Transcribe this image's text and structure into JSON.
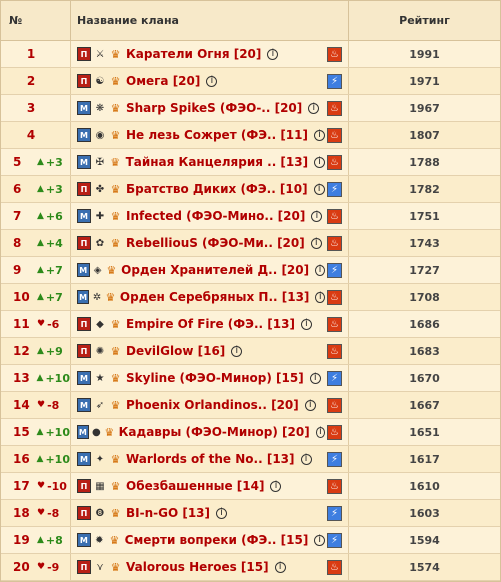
{
  "header": {
    "no": "№",
    "name": "Название клана",
    "rating": "Рейтинг"
  },
  "rows": [
    {
      "pos": "1",
      "change": "",
      "dir": "",
      "align": "П",
      "emblem": "⚔",
      "name": "Каратели Огня [20]",
      "element": "fire",
      "rating": "1991"
    },
    {
      "pos": "2",
      "change": "",
      "dir": "",
      "align": "П",
      "emblem": "☯",
      "name": "Омега [20]",
      "element": "air",
      "rating": "1971"
    },
    {
      "pos": "3",
      "change": "",
      "dir": "",
      "align": "М",
      "emblem": "❋",
      "name": "Sharp SpikeS (ФЭО-.. [20]",
      "element": "fire",
      "rating": "1967"
    },
    {
      "pos": "4",
      "change": "",
      "dir": "",
      "align": "М",
      "emblem": "◉",
      "name": "Не лезь Сожрет (ФЭ.. [11]",
      "element": "fire",
      "rating": "1807"
    },
    {
      "pos": "5",
      "change": "+3",
      "dir": "up",
      "align": "М",
      "emblem": "✠",
      "name": "Тайная Канцелярия .. [13]",
      "element": "fire",
      "rating": "1788"
    },
    {
      "pos": "6",
      "change": "+3",
      "dir": "up",
      "align": "П",
      "emblem": "✤",
      "name": "Братство Диких (ФЭ.. [10]",
      "element": "air",
      "rating": "1782"
    },
    {
      "pos": "7",
      "change": "+6",
      "dir": "up",
      "align": "М",
      "emblem": "✚",
      "name": "Infected (ФЭО-Мино.. [20]",
      "element": "fire",
      "rating": "1751"
    },
    {
      "pos": "8",
      "change": "+4",
      "dir": "up",
      "align": "П",
      "emblem": "✿",
      "name": "RebelliouS (ФЭО-Ми.. [20]",
      "element": "fire",
      "rating": "1743"
    },
    {
      "pos": "9",
      "change": "+7",
      "dir": "up",
      "align": "М",
      "emblem": "◈",
      "name": "Орден Хранителей Д.. [20]",
      "element": "air",
      "rating": "1727"
    },
    {
      "pos": "10",
      "change": "+7",
      "dir": "up",
      "align": "М",
      "emblem": "✲",
      "name": "Орден Серебряных П.. [13]",
      "element": "fire",
      "rating": "1708"
    },
    {
      "pos": "11",
      "change": "-6",
      "dir": "down",
      "align": "П",
      "emblem": "◆",
      "name": "Empire Of Fire (ФЭ.. [13]",
      "element": "fire",
      "rating": "1686"
    },
    {
      "pos": "12",
      "change": "+9",
      "dir": "up",
      "align": "П",
      "emblem": "✺",
      "name": "DevilGlow [16]",
      "element": "fire",
      "rating": "1683"
    },
    {
      "pos": "13",
      "change": "+10",
      "dir": "up",
      "align": "М",
      "emblem": "★",
      "name": "Skyline (ФЭО-Минор) [15]",
      "element": "air",
      "rating": "1670"
    },
    {
      "pos": "14",
      "change": "-8",
      "dir": "down",
      "align": "М",
      "emblem": "➶",
      "name": "Phoenix Orlandinos.. [20]",
      "element": "fire",
      "rating": "1667"
    },
    {
      "pos": "15",
      "change": "+10",
      "dir": "up",
      "align": "М",
      "emblem": "●",
      "name": "Кадавры (ФЭО-Минор) [20]",
      "element": "fire",
      "rating": "1651"
    },
    {
      "pos": "16",
      "change": "+10",
      "dir": "up",
      "align": "М",
      "emblem": "✦",
      "name": "Warlords of the No.. [13]",
      "element": "air",
      "rating": "1617"
    },
    {
      "pos": "17",
      "change": "-10",
      "dir": "down",
      "align": "П",
      "emblem": "▦",
      "name": "Обезбашенные [14]",
      "element": "fire",
      "rating": "1610"
    },
    {
      "pos": "18",
      "change": "-8",
      "dir": "down",
      "align": "П",
      "emblem": "❽",
      "name": "BI-n-GO [13]",
      "element": "air",
      "rating": "1603"
    },
    {
      "pos": "19",
      "change": "+8",
      "dir": "up",
      "align": "М",
      "emblem": "✹",
      "name": "Смерти вопреки (ФЭ.. [15]",
      "element": "air",
      "rating": "1594"
    },
    {
      "pos": "20",
      "change": "-9",
      "dir": "down",
      "align": "П",
      "emblem": "⋎",
      "name": "Valorous Heroes [15]",
      "element": "fire",
      "rating": "1574"
    }
  ]
}
